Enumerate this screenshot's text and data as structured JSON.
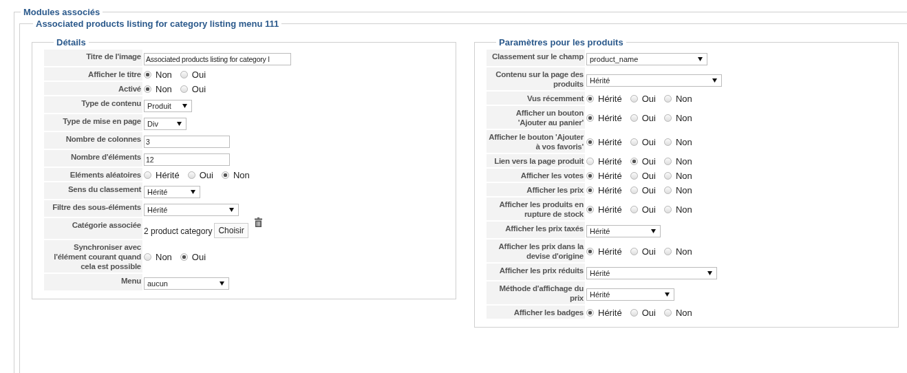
{
  "section": {
    "legend": "Modules associés"
  },
  "module": {
    "legend": "Associated products listing for category listing menu 111"
  },
  "panels": [
    {
      "legend": "Détails",
      "rows": [
        {
          "kind": "text",
          "label": "Titre de l'image",
          "value": "Associated products listing for category l"
        },
        {
          "kind": "radio",
          "label": "Afficher le titre",
          "options": [
            {
              "label": "Non",
              "selected": true
            },
            {
              "label": "Oui",
              "selected": false
            }
          ]
        },
        {
          "kind": "radio",
          "label": "Activé",
          "options": [
            {
              "label": "Non",
              "selected": true
            },
            {
              "label": "Oui",
              "selected": false
            }
          ]
        },
        {
          "kind": "select",
          "label": "Type de contenu",
          "value": "Produit"
        },
        {
          "kind": "select",
          "label": "Type de mise en page",
          "value": "Div"
        },
        {
          "kind": "text",
          "label": "Nombre de colonnes",
          "value": "3"
        },
        {
          "kind": "text",
          "label": "Nombre d'éléments",
          "value": "12"
        },
        {
          "kind": "radio",
          "label": "Eléments aléatoires",
          "options": [
            {
              "label": "Hérité",
              "selected": false
            },
            {
              "label": "Oui",
              "selected": false
            },
            {
              "label": "Non",
              "selected": true
            }
          ]
        },
        {
          "kind": "select",
          "label": "Sens du classement",
          "value": "Hérité"
        },
        {
          "kind": "select",
          "label": "Filtre des sous-éléments",
          "value": "Hérité"
        },
        {
          "kind": "chooser",
          "label": "Catégorie associée",
          "value": "2 product category",
          "button": "Choisir"
        },
        {
          "kind": "radio",
          "label": "Synchroniser avec l'élément courant quand cela est possible",
          "options": [
            {
              "label": "Non",
              "selected": false
            },
            {
              "label": "Oui",
              "selected": true
            }
          ]
        },
        {
          "kind": "select",
          "label": "Menu",
          "value": "aucun"
        }
      ]
    },
    {
      "legend": "Paramètres pour les produits",
      "rows": [
        {
          "kind": "select",
          "label": "Classement sur le champ",
          "value": "product_name"
        },
        {
          "kind": "select",
          "label": "Contenu sur la page des produits",
          "value": "Hérité"
        },
        {
          "kind": "radio",
          "label": "Vus récemment",
          "options": [
            {
              "label": "Hérité",
              "selected": true
            },
            {
              "label": "Oui",
              "selected": false
            },
            {
              "label": "Non",
              "selected": false
            }
          ]
        },
        {
          "kind": "radio",
          "label": "Afficher un bouton 'Ajouter au panier'",
          "options": [
            {
              "label": "Hérité",
              "selected": true
            },
            {
              "label": "Oui",
              "selected": false
            },
            {
              "label": "Non",
              "selected": false
            }
          ]
        },
        {
          "kind": "radio",
          "label": "Afficher le bouton 'Ajouter à vos favoris'",
          "options": [
            {
              "label": "Hérité",
              "selected": true
            },
            {
              "label": "Oui",
              "selected": false
            },
            {
              "label": "Non",
              "selected": false
            }
          ]
        },
        {
          "kind": "radio",
          "label": "Lien vers la page produit",
          "options": [
            {
              "label": "Hérité",
              "selected": false
            },
            {
              "label": "Oui",
              "selected": true
            },
            {
              "label": "Non",
              "selected": false
            }
          ]
        },
        {
          "kind": "radio",
          "label": "Afficher les votes",
          "options": [
            {
              "label": "Hérité",
              "selected": true
            },
            {
              "label": "Oui",
              "selected": false
            },
            {
              "label": "Non",
              "selected": false
            }
          ]
        },
        {
          "kind": "radio",
          "label": "Afficher les prix",
          "options": [
            {
              "label": "Hérité",
              "selected": true
            },
            {
              "label": "Oui",
              "selected": false
            },
            {
              "label": "Non",
              "selected": false
            }
          ]
        },
        {
          "kind": "radio",
          "label": "Afficher les produits en rupture de stock",
          "options": [
            {
              "label": "Hérité",
              "selected": true
            },
            {
              "label": "Oui",
              "selected": false
            },
            {
              "label": "Non",
              "selected": false
            }
          ]
        },
        {
          "kind": "select",
          "label": "Afficher les prix taxés",
          "value": "Hérité"
        },
        {
          "kind": "radio",
          "label": "Afficher les prix dans la devise d'origine",
          "options": [
            {
              "label": "Hérité",
              "selected": true
            },
            {
              "label": "Oui",
              "selected": false
            },
            {
              "label": "Non",
              "selected": false
            }
          ]
        },
        {
          "kind": "select",
          "label": "Afficher les prix réduits",
          "value": "Hérité"
        },
        {
          "kind": "select",
          "label": "Méthode d'affichage du prix",
          "value": "Hérité"
        },
        {
          "kind": "radio",
          "label": "Afficher les badges",
          "options": [
            {
              "label": "Hérité",
              "selected": true
            },
            {
              "label": "Oui",
              "selected": false
            },
            {
              "label": "Non",
              "selected": false
            }
          ]
        }
      ]
    }
  ]
}
